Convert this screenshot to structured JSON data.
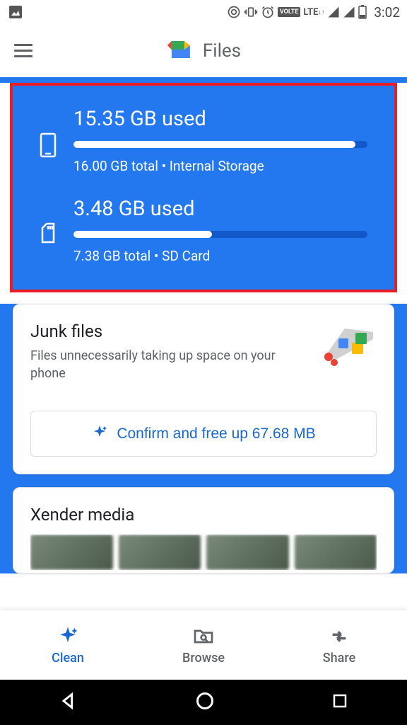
{
  "statusBar": {
    "time": "3:02"
  },
  "header": {
    "title": "Files"
  },
  "storage": {
    "internal": {
      "used": "15.35 GB used",
      "total": "16.00 GB total • Internal Storage",
      "percent": 96
    },
    "sd": {
      "used": "3.48 GB used",
      "total": "7.38 GB total • SD Card",
      "percent": 47
    }
  },
  "junkCard": {
    "title": "Junk files",
    "subtitle": "Files unnecessarily taking up space on your phone",
    "action": "Confirm and free up 67.68 MB"
  },
  "xenderCard": {
    "title": "Xender media"
  },
  "bottomNav": {
    "clean": "Clean",
    "browse": "Browse",
    "share": "Share"
  }
}
